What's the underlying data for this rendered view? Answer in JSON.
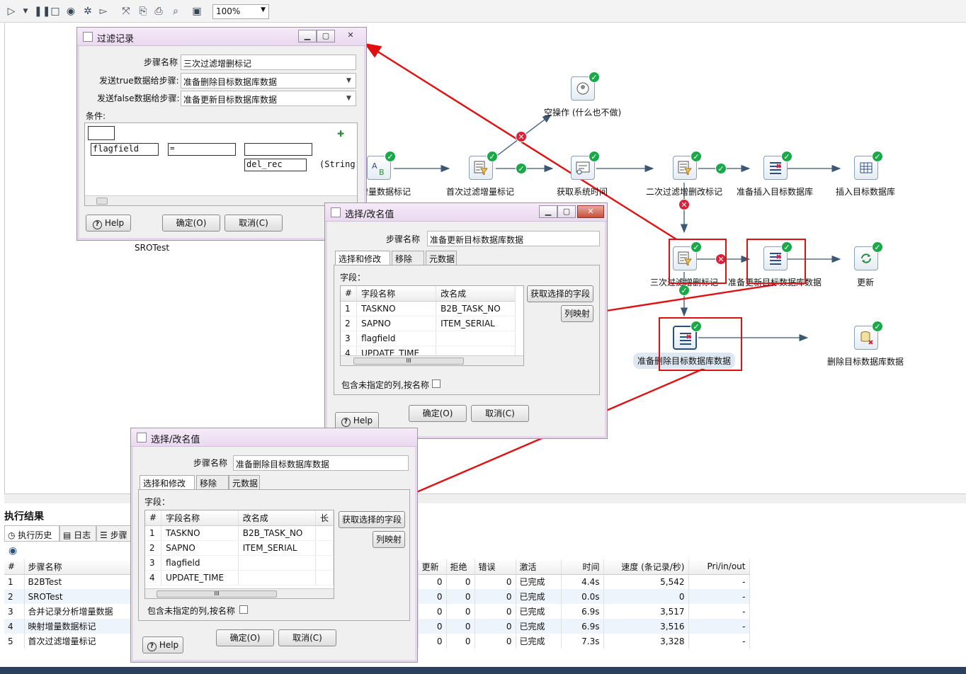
{
  "toolbar": {
    "zoom": "100%",
    "icons": [
      "run-icon",
      "dropdown-icon",
      "pause-icon",
      "stop-icon",
      "preview-icon",
      "debug-icon",
      "replay-icon",
      "verify-icon",
      "impact-icon",
      "sql-icon",
      "explore-db-icon",
      "show-results-icon"
    ]
  },
  "canvas": {
    "steps": [
      {
        "id": "b2b-mark",
        "label": "增量数据标记",
        "icon": "ab-icon"
      },
      {
        "id": "first-filter",
        "label": "首次过滤增量标记",
        "icon": "filter-icon"
      },
      {
        "id": "noop",
        "label": "空操作 (什么也不做)",
        "icon": "noop-icon"
      },
      {
        "id": "get-time",
        "label": "获取系统时间",
        "icon": "sysinfo-icon"
      },
      {
        "id": "second-filter",
        "label": "二次过滤增删改标记",
        "icon": "filter-icon"
      },
      {
        "id": "prep-insert",
        "label": "准备插入目标数据库",
        "icon": "select-values-icon"
      },
      {
        "id": "insert",
        "label": "插入目标数据库",
        "icon": "table-output-icon"
      },
      {
        "id": "third-filter",
        "label": "三次过滤增删标记",
        "icon": "filter-icon"
      },
      {
        "id": "prep-update",
        "label": "准备更新目标数据库数据",
        "icon": "select-values-icon"
      },
      {
        "id": "update",
        "label": "更新",
        "icon": "update-icon"
      },
      {
        "id": "prep-delete",
        "label": "准备删除目标数据库数据",
        "icon": "select-values-icon"
      },
      {
        "id": "delete",
        "label": "删除目标数据库数据",
        "icon": "delete-icon"
      }
    ],
    "sro_label": "SROTest"
  },
  "filter_dialog": {
    "title": "过滤记录",
    "step_name_label": "步骤名称",
    "step_name": "三次过滤增删标记",
    "true_label": "发送true数据给步骤:",
    "true_value": "准备删除目标数据库数据",
    "false_label": "发送false数据给步骤:",
    "false_value": "准备更新目标数据库数据",
    "cond_label": "条件:",
    "cond_field": "flagfield",
    "cond_op": "=",
    "cond_value": "del_rec",
    "cond_type": "(String",
    "help": "Help",
    "ok": "确定(O)",
    "cancel": "取消(C)"
  },
  "select_dialog_update": {
    "title": "选择/改名值",
    "step_name_label": "步骤名称",
    "step_name": "准备更新目标数据库数据",
    "tabs": [
      "选择和修改",
      "移除",
      "元数据"
    ],
    "fields_label": "字段：",
    "col_hash": "#",
    "col_name": "字段名称",
    "col_rename": "改名成",
    "rows": [
      {
        "n": "1",
        "name": "TASKNO",
        "rename": "B2B_TASK_NO"
      },
      {
        "n": "2",
        "name": "SAPNO",
        "rename": "ITEM_SERIAL"
      },
      {
        "n": "3",
        "name": "flagfield",
        "rename": ""
      },
      {
        "n": "4",
        "name": "UPDATE_TIME",
        "rename": ""
      }
    ],
    "get_fields": "获取选择的字段",
    "map": "列映射",
    "include_unspecified": "包含未指定的列,按名称",
    "help": "Help",
    "ok": "确定(O)",
    "cancel": "取消(C)"
  },
  "select_dialog_delete": {
    "title": "选择/改名值",
    "step_name_label": "步骤名称",
    "step_name": "准备删除目标数据库数据",
    "tabs": [
      "选择和修改",
      "移除",
      "元数据"
    ],
    "fields_label": "字段：",
    "col_hash": "#",
    "col_name": "字段名称",
    "col_rename": "改名成",
    "col_extra": "长",
    "rows": [
      {
        "n": "1",
        "name": "TASKNO",
        "rename": "B2B_TASK_NO"
      },
      {
        "n": "2",
        "name": "SAPNO",
        "rename": "ITEM_SERIAL"
      },
      {
        "n": "3",
        "name": "flagfield",
        "rename": ""
      },
      {
        "n": "4",
        "name": "UPDATE_TIME",
        "rename": ""
      }
    ],
    "get_fields": "获取选择的字段",
    "map": "列映射",
    "include_unspecified": "包含未指定的列,按名称",
    "help": "Help",
    "ok": "确定(O)",
    "cancel": "取消(C)"
  },
  "results": {
    "title": "执行结果",
    "tabs": [
      "执行历史",
      "日志",
      "步骤"
    ],
    "columns": [
      "#",
      "步骤名称",
      "更新",
      "拒绝",
      "错误",
      "激活",
      "时间",
      "速度 (条记录/秒)",
      "Pri/in/out"
    ],
    "rows": [
      {
        "n": "1",
        "name": "B2BTest",
        "upd": "0",
        "rej": "0",
        "err": "0",
        "act": "已完成",
        "time": "4.4s",
        "speed": "5,542",
        "pri": "-"
      },
      {
        "n": "2",
        "name": "SROTest",
        "upd": "0",
        "rej": "0",
        "err": "0",
        "act": "已完成",
        "time": "0.0s",
        "speed": "0",
        "pri": "-"
      },
      {
        "n": "3",
        "name": "合并记录分析增量数据",
        "upd": "0",
        "rej": "0",
        "err": "0",
        "act": "已完成",
        "time": "6.9s",
        "speed": "3,517",
        "pri": "-"
      },
      {
        "n": "4",
        "name": "映射增量数据标记",
        "upd": "0",
        "rej": "0",
        "err": "0",
        "act": "已完成",
        "time": "6.9s",
        "speed": "3,516",
        "pri": "-"
      },
      {
        "n": "5",
        "name": "首次过滤增量标记",
        "upd": "0",
        "rej": "0",
        "err": "0",
        "act": "已完成",
        "time": "7.3s",
        "speed": "3,328",
        "pri": "-"
      }
    ]
  }
}
